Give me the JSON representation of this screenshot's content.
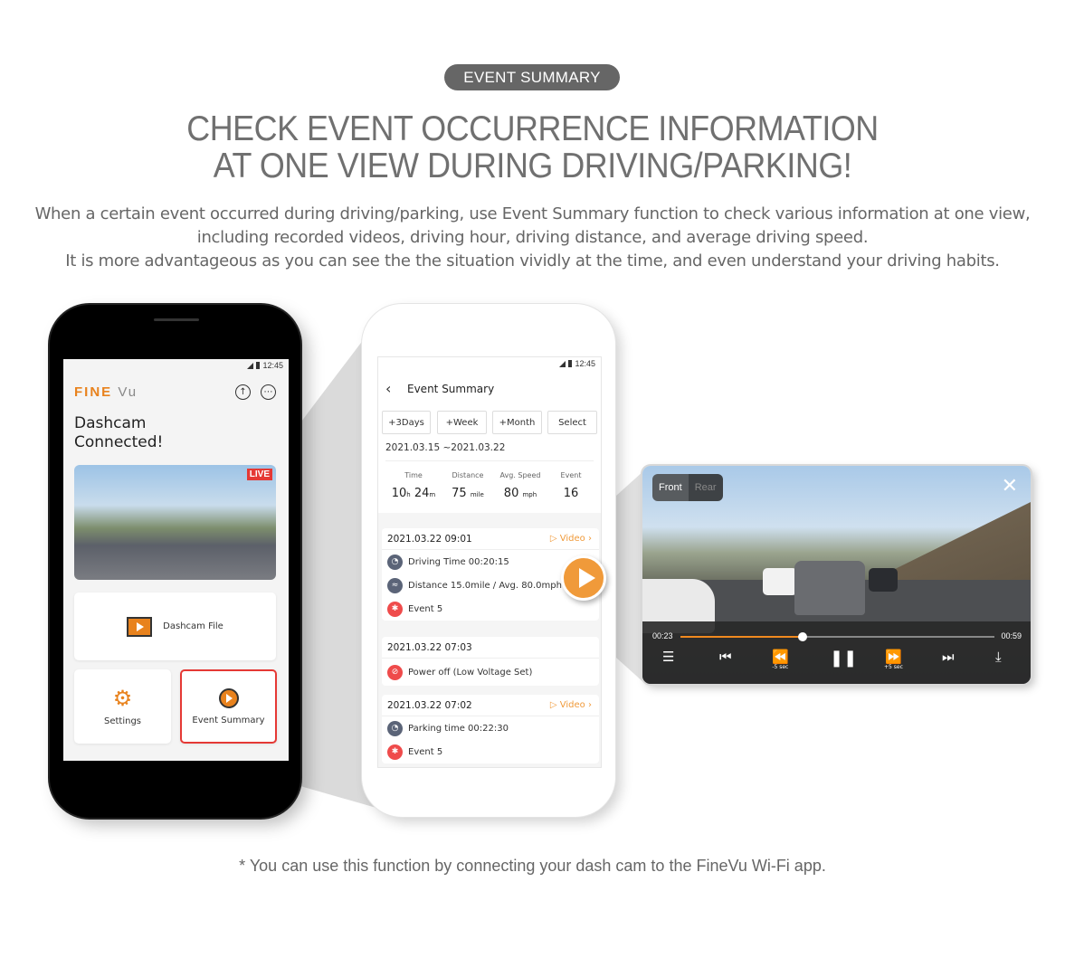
{
  "header": {
    "badge": "EVENT SUMMARY",
    "headline_line1": "CHECK EVENT OCCURRENCE INFORMATION",
    "headline_line2": "AT ONE VIEW DURING DRIVING/PARKING!",
    "desc_line1": "When a certain event occurred during driving/parking, use Event Summary function to check various information at one view,",
    "desc_line2": "including recorded videos, driving hour, driving distance, and average driving speed.",
    "desc_line3": "It is more advantageous as you can see the the situation vividly at the time, and even understand your driving habits."
  },
  "footnote": "* You can use this function by connecting your dash cam to the FineVu Wi-Fi app.",
  "colors": {
    "accent": "#e8821d",
    "video_orange": "#f09a3a",
    "alert_red": "#e53935",
    "badge_gray": "#666666"
  },
  "left_phone": {
    "status_time": "12:45",
    "logo_fine": "FINE",
    "logo_vu": "Vu",
    "icons": {
      "upload": "upload-icon",
      "more": "more-icon"
    },
    "connected_line1": "Dashcam",
    "connected_line2": "Connected!",
    "live_badge": "LIVE",
    "tiles": {
      "file": "Dashcam File",
      "settings": "Settings",
      "event_summary": "Event Summary"
    }
  },
  "mid_phone": {
    "status_time": "12:45",
    "title": "Event Summary",
    "filters": [
      "+3Days",
      "+Week",
      "+Month",
      "Select"
    ],
    "date_range": "2021.03.15 ~2021.03.22",
    "stats": {
      "time_label": "Time",
      "time_h": "10",
      "time_h_unit": "h",
      "time_m": "24",
      "time_m_unit": "m",
      "distance_label": "Distance",
      "distance_val": "75",
      "distance_unit": "mile",
      "speed_label": "Avg. Speed",
      "speed_val": "80",
      "speed_unit": "mph",
      "event_label": "Event",
      "event_val": "16"
    },
    "cards": [
      {
        "datetime": "2021.03.22 09:01",
        "video": "Video",
        "rows": [
          "Driving Time  00:20:15",
          "Distance 15.0mile / Avg. 80.0mph",
          "Event  5"
        ]
      },
      {
        "datetime": "2021.03.22 07:03",
        "rows": [
          "Power off (Low Voltage Set)"
        ]
      },
      {
        "datetime": "2021.03.22 07:02",
        "video": "Video",
        "rows": [
          "Parking time  00:22:30",
          "Event  5"
        ]
      }
    ]
  },
  "video_player": {
    "tab_front": "Front",
    "tab_rear": "Rear",
    "current_time": "00:23",
    "total_time": "00:59",
    "progress_fraction": 0.39,
    "rewind_label": "-5",
    "forward_label": "+5",
    "sec_unit": "sec"
  }
}
